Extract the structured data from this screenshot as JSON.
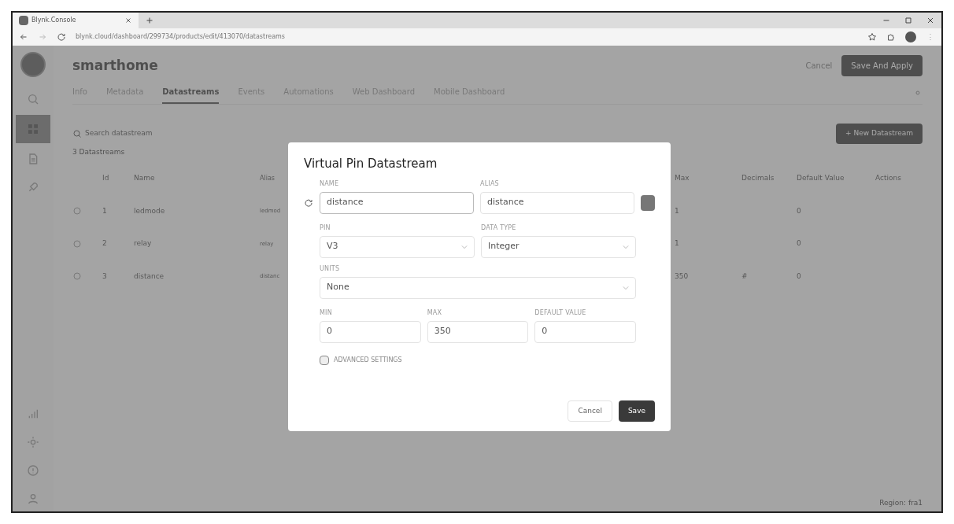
{
  "browser": {
    "tab_title": "Blynk.Console",
    "url": "blynk.cloud/dashboard/299734/products/edit/413070/datastreams"
  },
  "header": {
    "title": "smarthome",
    "cancel": "Cancel",
    "save": "Save And Apply"
  },
  "tabs": [
    {
      "label": "Info",
      "selected": false
    },
    {
      "label": "Metadata",
      "selected": false
    },
    {
      "label": "Datastreams",
      "selected": true
    },
    {
      "label": "Events",
      "selected": false
    },
    {
      "label": "Automations",
      "selected": false
    },
    {
      "label": "Web Dashboard",
      "selected": false
    },
    {
      "label": "Mobile Dashboard",
      "selected": false
    }
  ],
  "search": {
    "placeholder": "Search datastream"
  },
  "new_button": "+ New Datastream",
  "count": "3 Datastreams",
  "table": {
    "columns": [
      "Id",
      "Name",
      "Alias",
      "Max",
      "Decimals",
      "Default Value",
      "Actions"
    ],
    "rows": [
      {
        "id": "1",
        "name": "ledmode",
        "alias": "ledmod",
        "max": "1",
        "decimals": "",
        "default": "0"
      },
      {
        "id": "2",
        "name": "relay",
        "alias": "relay",
        "max": "1",
        "decimals": "",
        "default": "0"
      },
      {
        "id": "3",
        "name": "distance",
        "alias": "distanc",
        "max": "350",
        "decimals": "#",
        "default": "0"
      }
    ]
  },
  "footer": "Region: fra1",
  "modal": {
    "title": "Virtual Pin Datastream",
    "fields": [
      {
        "label": "NAME",
        "value": "distance",
        "kind": "input"
      },
      {
        "label": "ALIAS",
        "value": "distance",
        "kind": "input"
      },
      {
        "label": "PIN",
        "value": "V3",
        "kind": "select"
      },
      {
        "label": "DATA TYPE",
        "value": "Integer",
        "kind": "select"
      },
      {
        "label": "UNITS",
        "value": "None",
        "kind": "select"
      },
      {
        "label": "MIN",
        "value": "0",
        "kind": "input"
      },
      {
        "label": "MAX",
        "value": "350",
        "kind": "input"
      },
      {
        "label": "DEFAULT VALUE",
        "value": "0",
        "kind": "input"
      }
    ],
    "advanced": {
      "label": "ADVANCED SETTINGS",
      "checked": false
    },
    "cancel": "Cancel",
    "save": "Save"
  }
}
